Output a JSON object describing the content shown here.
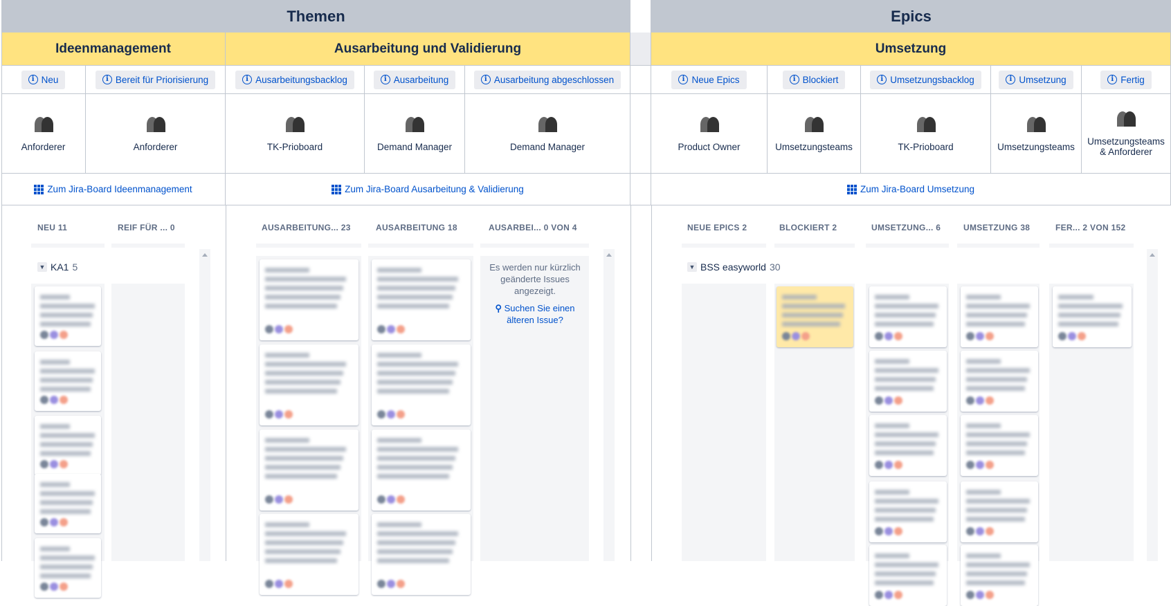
{
  "header": {
    "themen": "Themen",
    "epics": "Epics"
  },
  "phases": {
    "ideen": "Ideenmanagement",
    "ausarbeitung": "Ausarbeitung und Validierung",
    "umsetzung": "Umsetzung"
  },
  "status_buttons": [
    "Neu",
    "Bereit für Priorisierung",
    "Ausarbeitungsbacklog",
    "Ausarbeitung",
    "Ausarbeitung abgeschlossen",
    "Neue Epics",
    "Blockiert",
    "Umsetzungsbacklog",
    "Umsetzung",
    "Fertig"
  ],
  "roles": [
    "Anforderer",
    "Anforderer",
    "TK-Prioboard",
    "Demand Manager",
    "Demand Manager",
    "Product Owner",
    "Umsetzungsteams",
    "TK-Prioboard",
    "Umsetzungsteams",
    "Umsetzungsteams & Anforderer"
  ],
  "board_links": {
    "ideen": "Zum Jira-Board Ideenmanagement",
    "ausarbeitung": "Zum Jira-Board Ausarbeitung & Validierung",
    "umsetzung": "Zum Jira-Board Umsetzung"
  },
  "boards": {
    "ideen": {
      "columns": [
        "NEU 11",
        "REIF FÜR ... 0"
      ],
      "swimlane": {
        "name": "KA1",
        "count": "5"
      }
    },
    "ausarbeitung": {
      "columns": [
        "AUSARBEITUNG...  23",
        "AUSARBEITUNG 18",
        "AUSARBEI...   0 VON 4"
      ],
      "message": "Es werden nur kürzlich geänderte Issues angezeigt.",
      "search_link": "Suchen Sie einen älteren Issue?"
    },
    "umsetzung": {
      "columns": [
        "NEUE EPICS 2",
        "BLOCKIERT 2",
        "UMSETZUNG... 6",
        "UMSETZUNG 38",
        "FER... 2 VON 152"
      ],
      "swimlane": {
        "name": "BSS easyworld",
        "count": "30"
      }
    }
  },
  "colors": {
    "header": "#C1C7D0",
    "phase": "#FFE380",
    "link": "#0052CC",
    "button": "#EBECF0",
    "blocked_card": "#FFE9A8"
  }
}
